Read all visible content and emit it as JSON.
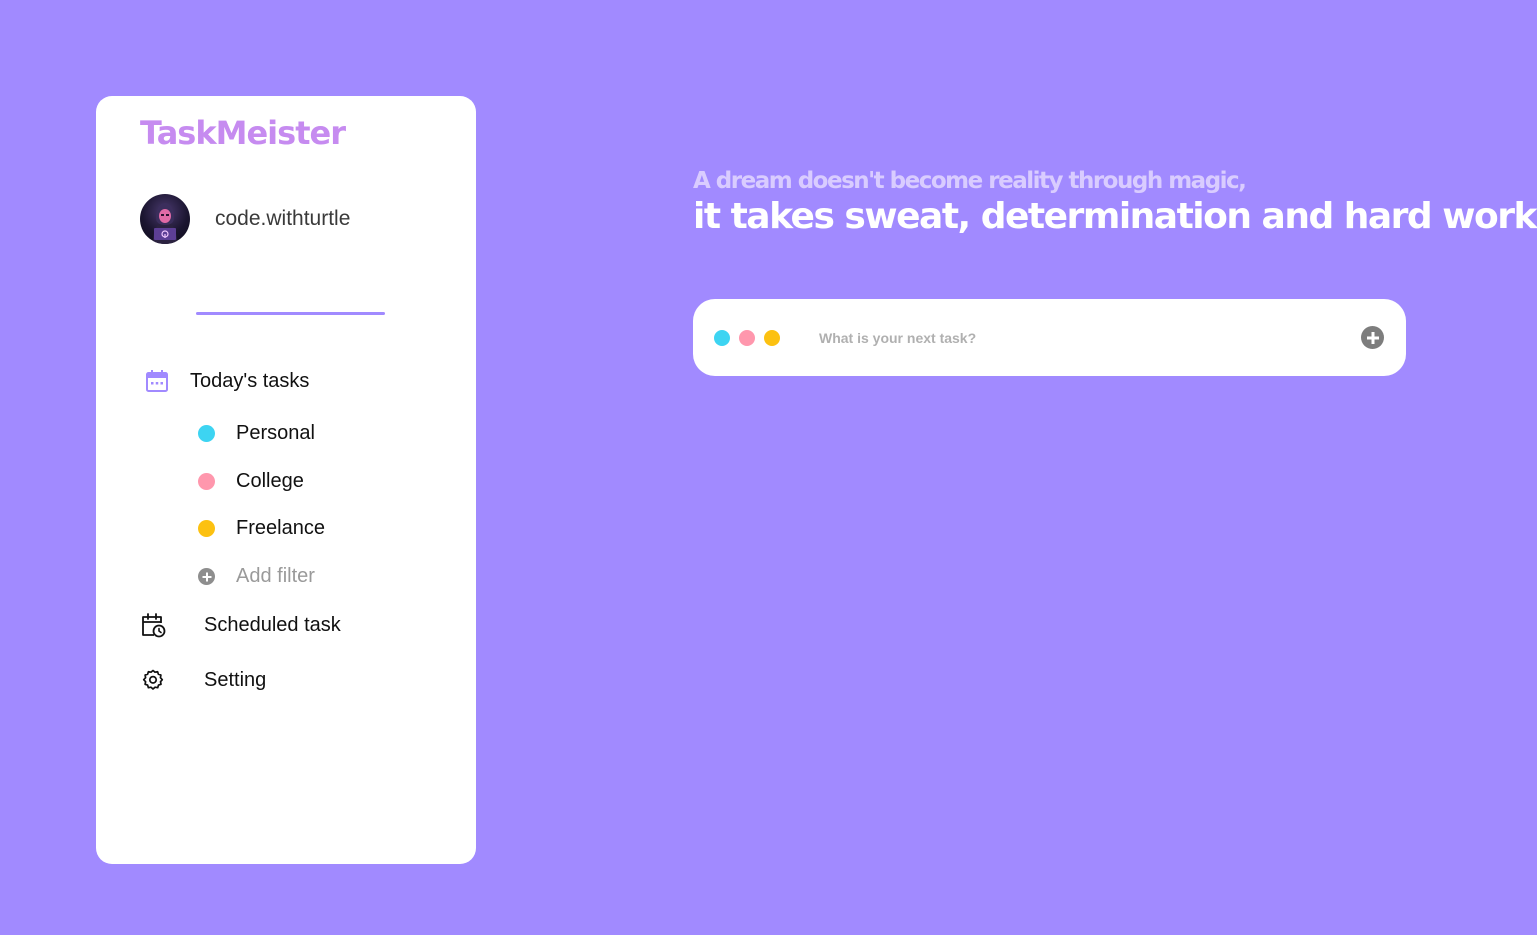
{
  "app": {
    "title": "TaskMeister"
  },
  "profile": {
    "username": "code.withturtle"
  },
  "nav": {
    "today": {
      "label": "Today's tasks",
      "icon": "calendar-icon"
    },
    "scheduled": {
      "label": "Scheduled task",
      "icon": "calendar-clock-icon"
    },
    "setting": {
      "label": "Setting",
      "icon": "gear-icon"
    }
  },
  "filters": [
    {
      "label": "Personal",
      "color": "#3dd4f2"
    },
    {
      "label": "College",
      "color": "#ff97ad"
    },
    {
      "label": "Freelance",
      "color": "#fcc111"
    }
  ],
  "add_filter": {
    "label": "Add filter",
    "icon": "plus-circle-icon"
  },
  "quote": {
    "line1": "A dream doesn't become reality through magic,",
    "line2": "it takes sweat, determination and hard work",
    "emoji": "sparkles-icon"
  },
  "task_input": {
    "placeholder": "What is your next task?",
    "value": "",
    "dot_colors": [
      "#3dd4f2",
      "#ff97ad",
      "#fcc111"
    ],
    "add_icon": "plus-circle-icon"
  },
  "colors": {
    "background": "#a18aff",
    "brand": "#c68bf0",
    "accent": "#a18aff"
  }
}
